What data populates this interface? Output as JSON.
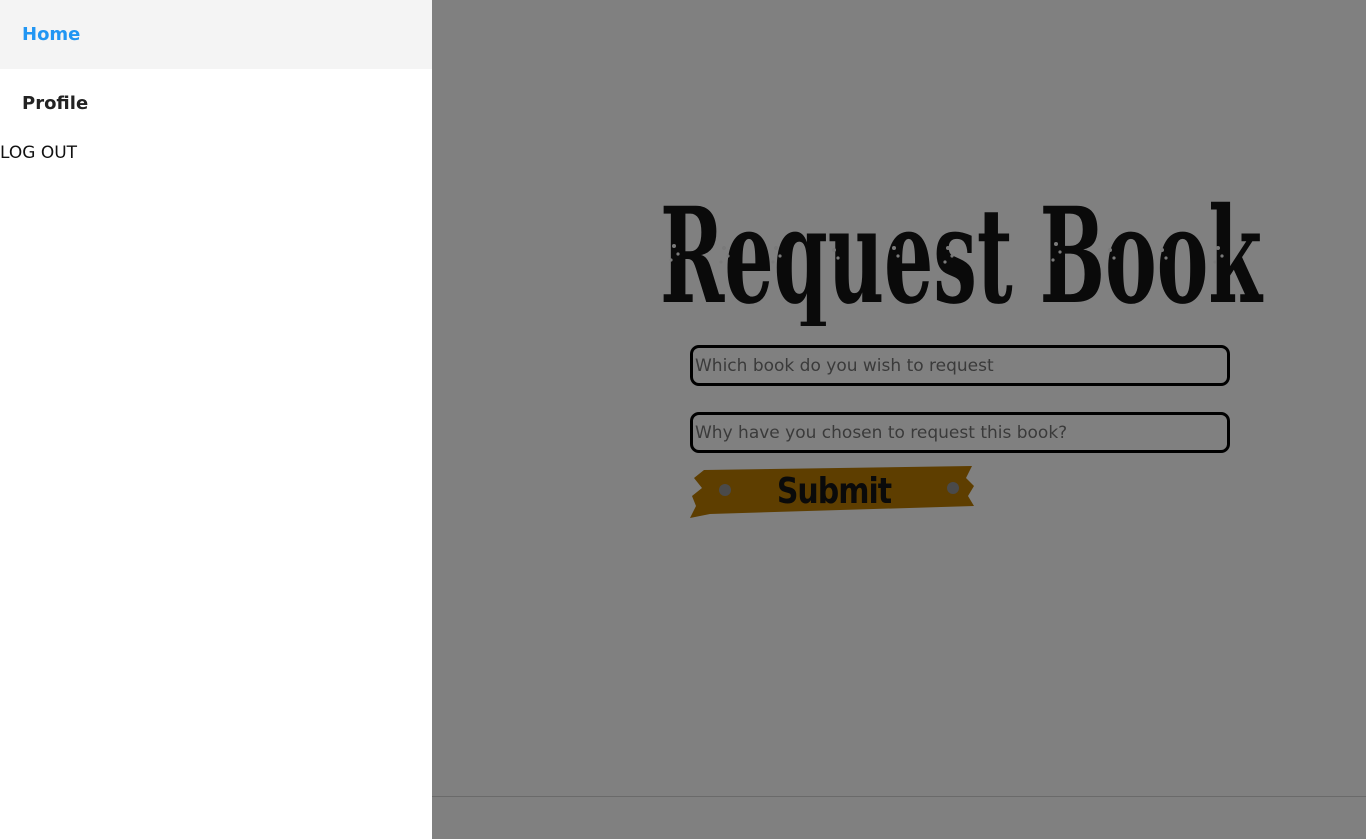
{
  "drawer": {
    "items": [
      {
        "label": "Home",
        "active": true
      },
      {
        "label": "Profile",
        "active": false
      }
    ],
    "logout_label": "LOG OUT"
  },
  "main": {
    "title": "Request Book",
    "fields": [
      {
        "placeholder": "Which book do you wish to request",
        "value": ""
      },
      {
        "placeholder": "Why have you chosen to request this book?",
        "value": ""
      }
    ],
    "submit_label": "Submit"
  },
  "colors": {
    "active_link": "#2196f3",
    "overlay": "#808080",
    "submit_banner": "#5e3e00"
  }
}
